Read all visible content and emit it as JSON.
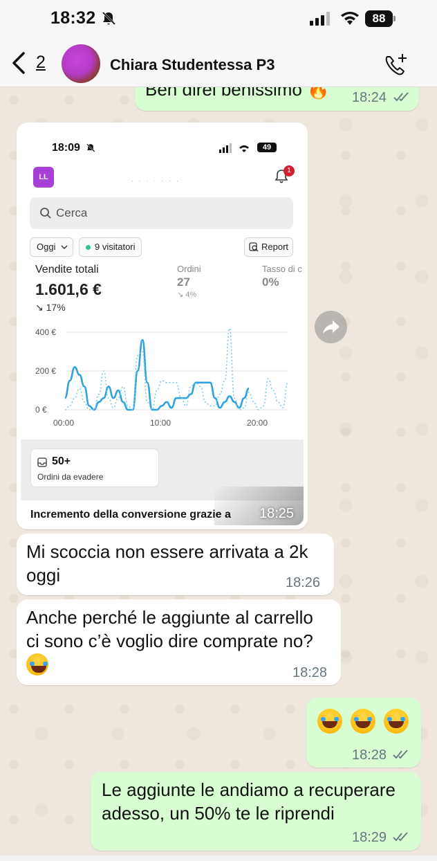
{
  "status_bar": {
    "time": "18:32",
    "battery": "88"
  },
  "header": {
    "back_count": "2",
    "contact_name": "Chiara Studentessa P3"
  },
  "messages": [
    {
      "text": "Ben direi benissimo 🔥",
      "time": "18:24"
    },
    {
      "time": "18:25"
    },
    {
      "line1": "Mi scoccia non essere arrivata a 2k",
      "line2": "oggi",
      "time": "18:26"
    },
    {
      "line1": "Anche perché le aggiunte al carrello",
      "line2": "ci sono c’è voglio dire comprate no?",
      "time": "18:28"
    },
    {
      "time": "18:28"
    },
    {
      "line1": "Le aggiunte le andiamo a recuperare",
      "line2": "adesso, un 50% te le riprendi",
      "time": "18:29"
    }
  ],
  "screenshot": {
    "time": "18:09",
    "battery": "49",
    "logo": "LL",
    "store_name": "· · · · · · ·",
    "notification_count": "1",
    "search_placeholder": "Cerca",
    "period": "Oggi",
    "visitors": "9 visitatori",
    "report": "Report",
    "kpis": [
      {
        "label": "Vendite totali",
        "value": "1.601,6 €",
        "delta": "↘ 17%"
      },
      {
        "label": "Ordini",
        "value": "27",
        "delta": "↘ 4%"
      },
      {
        "label": "Tasso di c",
        "value": "0%"
      }
    ],
    "card": {
      "number": "50+",
      "label": "Ordini da evadere"
    },
    "promo": "Incremento della conversione grazie a"
  },
  "chart_data": {
    "type": "line",
    "y_ticks": [
      "400 €",
      "200 €",
      "0 €"
    ],
    "x_ticks": [
      "00:00",
      "10:00",
      "20:00"
    ],
    "ylim": [
      0,
      400
    ],
    "x_range": [
      0,
      23
    ],
    "series": [
      {
        "style": "solid",
        "color": "#2ea3e0",
        "x": [
          0,
          0.5,
          1,
          1.5,
          2,
          2.5,
          3,
          3.5,
          4,
          4.5,
          5,
          5.5,
          6,
          6.5,
          7,
          7.5,
          8,
          8.5,
          9,
          9.5,
          10,
          10.5,
          11,
          11.5,
          12,
          12.5,
          13,
          13.5,
          14,
          14.5,
          15,
          15.5,
          16,
          16.5,
          17,
          17.5,
          18,
          18.5,
          19
        ],
        "values": [
          60,
          150,
          220,
          180,
          120,
          20,
          0,
          40,
          60,
          120,
          60,
          100,
          40,
          0,
          0,
          200,
          360,
          140,
          0,
          0,
          20,
          40,
          10,
          60,
          60,
          60,
          80,
          140,
          140,
          140,
          140,
          60,
          10,
          40,
          70,
          40,
          10,
          60,
          110
        ]
      },
      {
        "style": "dotted",
        "color": "#7fc8ec",
        "x": [
          0,
          0.5,
          1,
          1.5,
          2,
          2.5,
          3,
          3.5,
          4,
          4.5,
          5,
          5.5,
          6,
          6.5,
          7,
          7.5,
          8,
          8.5,
          9,
          9.5,
          10,
          10.5,
          11,
          11.5,
          12,
          12.5,
          13,
          13.5,
          14,
          14.5,
          15,
          15.5,
          16,
          16.5,
          17,
          17.5,
          18,
          18.5,
          19,
          19.5,
          20,
          20.5,
          21,
          21.5,
          22,
          22.5,
          23
        ],
        "values": [
          0,
          20,
          60,
          110,
          40,
          0,
          0,
          80,
          200,
          60,
          10,
          60,
          120,
          20,
          0,
          280,
          300,
          40,
          0,
          100,
          150,
          140,
          140,
          140,
          60,
          20,
          120,
          140,
          120,
          40,
          20,
          20,
          80,
          150,
          420,
          60,
          0,
          10,
          90,
          40,
          0,
          20,
          160,
          100,
          40,
          10,
          140
        ]
      }
    ]
  },
  "colors": {
    "outgoing": "#d9fdd3",
    "incoming": "#ffffff",
    "accent_logo": "#a83fd6"
  }
}
